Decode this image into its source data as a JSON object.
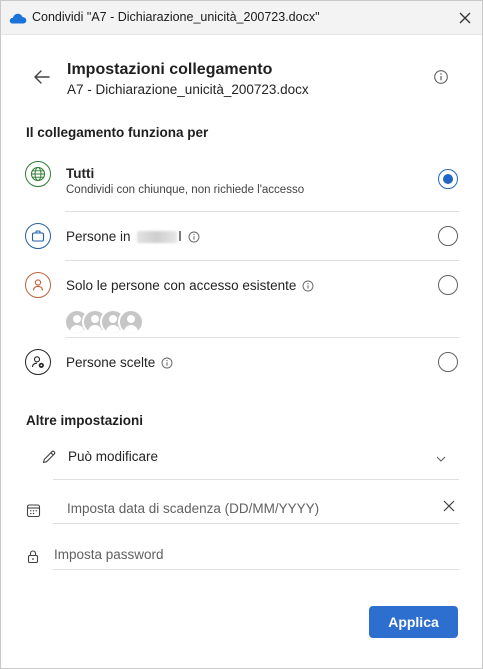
{
  "window": {
    "title": "Condividi \"A7 - Dichiarazione_unicità_200723.docx\""
  },
  "header": {
    "title": "Impostazioni collegamento",
    "subtitle": "A7 - Dichiarazione_unicità_200723.docx"
  },
  "link_works_for": {
    "label": "Il collegamento funziona per",
    "selected": "Tutti",
    "options": [
      {
        "label": "Tutti",
        "description": "Condividi con chiunque, non richiede l'accesso",
        "icon": "globe-icon",
        "icon_color": "#2e7d32",
        "checked": true
      },
      {
        "label": "Persone in",
        "suffix": "l",
        "icon": "briefcase-icon",
        "icon_color": "#1f5fa8",
        "checked": false
      },
      {
        "label": "Solo le persone con accesso esistente",
        "icon": "person-icon",
        "icon_color": "#c0643a",
        "checked": false
      },
      {
        "label": "Persone scelte",
        "icon": "person-settings-icon",
        "icon_color": "#242424",
        "checked": false
      }
    ]
  },
  "other_settings": {
    "label": "Altre impostazioni",
    "permission": "Può modificare",
    "expiry_placeholder": "Imposta data di scadenza (DD/MM/YYYY)",
    "password_placeholder": "Imposta password"
  },
  "actions": {
    "apply_label": "Applica"
  },
  "colors": {
    "accent": "#2d6fcf",
    "radio_selected": "#2266c4"
  }
}
